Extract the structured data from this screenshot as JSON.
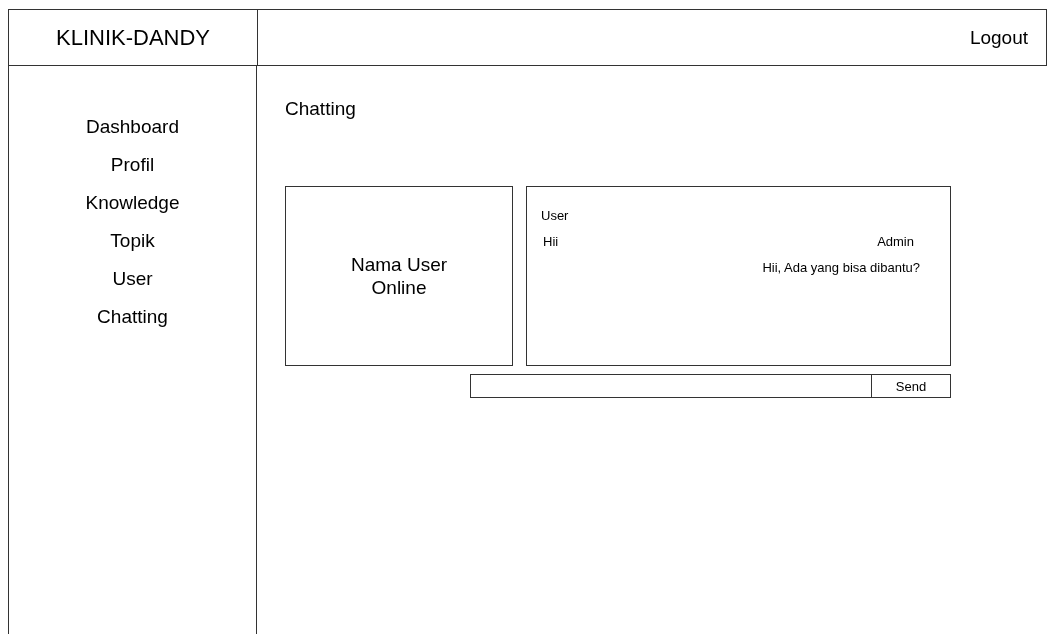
{
  "brand": "KLINIK-DANDY",
  "logout": "Logout",
  "sidebar": {
    "items": [
      {
        "label": "Dashboard"
      },
      {
        "label": "Profil"
      },
      {
        "label": "Knowledge"
      },
      {
        "label": "Topik"
      },
      {
        "label": "User"
      },
      {
        "label": "Chatting"
      }
    ]
  },
  "page_title": "Chatting",
  "online_panel": {
    "text": "Nama User Online"
  },
  "messages": [
    {
      "kind": "incoming",
      "sender": "User",
      "text": "Hii"
    },
    {
      "kind": "outgoing",
      "sender": "Admin",
      "text": "Hii, Ada yang bisa dibantu?"
    }
  ],
  "composer": {
    "button": "Send"
  }
}
